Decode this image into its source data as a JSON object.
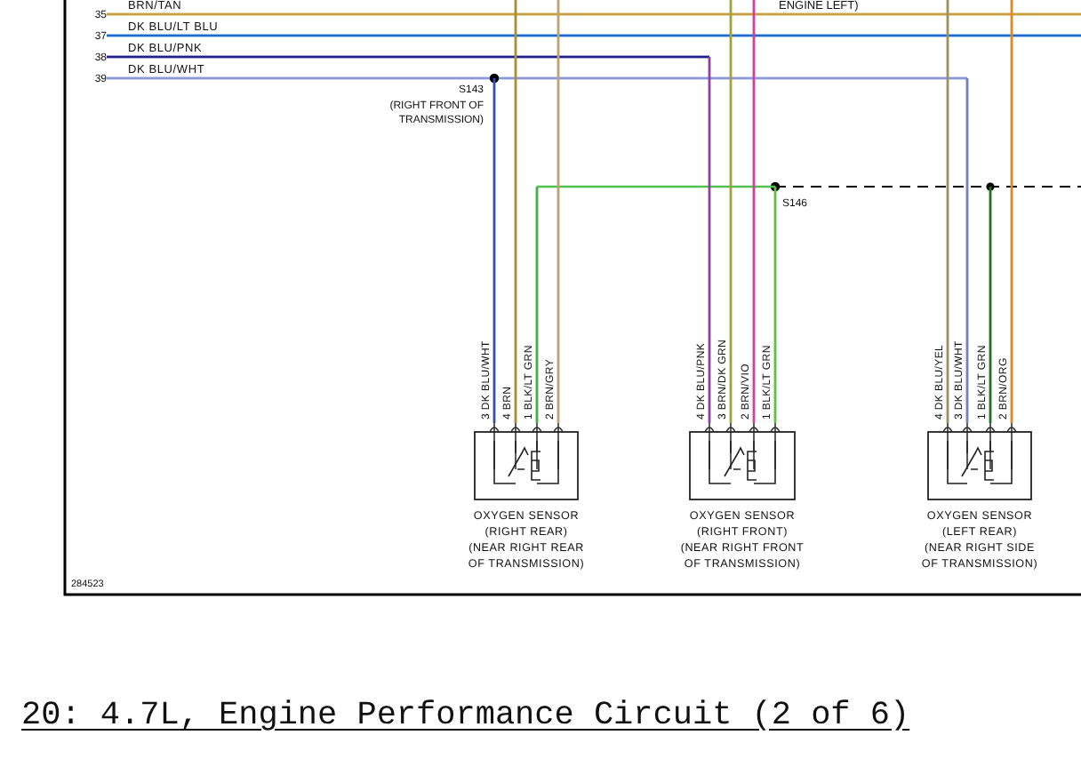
{
  "diagram": {
    "note": "ENGINE LEFT)",
    "wires": [
      {
        "number": "35",
        "label": "BRN/TAN",
        "color": "#c8a040"
      },
      {
        "number": "37",
        "label": "DK BLU/LT BLU",
        "color": "#1a6ad0"
      },
      {
        "number": "38",
        "label": "DK BLU/PNK",
        "color": "#20208a"
      },
      {
        "number": "39",
        "label": "DK BLU/WHT",
        "color": "#8a9ad8"
      }
    ],
    "splices": [
      {
        "label": "S143",
        "location": [
          "(RIGHT FRONT OF",
          "TRANSMISSION)"
        ]
      },
      {
        "label": "S146"
      }
    ],
    "sensors": [
      {
        "name": "OXYGEN SENSOR",
        "lines": [
          "(RIGHT REAR)",
          "(NEAR RIGHT REAR",
          "OF TRANSMISSION)"
        ],
        "pins": [
          {
            "label": "3 DK BLU/WHT",
            "color": "#3050b0"
          },
          {
            "label": "4 BRN",
            "color": "#b08a30"
          },
          {
            "label": "1 BLK/LT GRN",
            "color": "#40b040"
          },
          {
            "label": "2 BRN/GRY",
            "color": "#c0a070"
          }
        ]
      },
      {
        "name": "OXYGEN SENSOR",
        "lines": [
          "(RIGHT FRONT)",
          "(NEAR RIGHT FRONT",
          "OF TRANSMISSION)"
        ],
        "pins": [
          {
            "label": "4 DK BLU/PNK",
            "color": "#9040a0"
          },
          {
            "label": "3 BRN/DK GRN",
            "color": "#a0a040"
          },
          {
            "label": "2 BRN/VIO",
            "color": "#d040a0"
          },
          {
            "label": "1 BLK/LT GRN",
            "color": "#60c040"
          }
        ]
      },
      {
        "name": "OXYGEN SENSOR",
        "lines": [
          "(LEFT REAR)",
          "(NEAR RIGHT SIDE",
          "OF TRANSMISSION)"
        ],
        "pins": [
          {
            "label": "4 DK BLU/YEL",
            "color": "#a09060"
          },
          {
            "label": "3 DK BLU/WHT",
            "color": "#7080c0"
          },
          {
            "label": "1 BLK/LT GRN",
            "color": "#207020"
          },
          {
            "label": "2 BRN/ORG",
            "color": "#e08820"
          }
        ]
      }
    ],
    "figure_id": "284523"
  },
  "caption": "20: 4.7L, Engine Performance Circuit (2 of 6)"
}
